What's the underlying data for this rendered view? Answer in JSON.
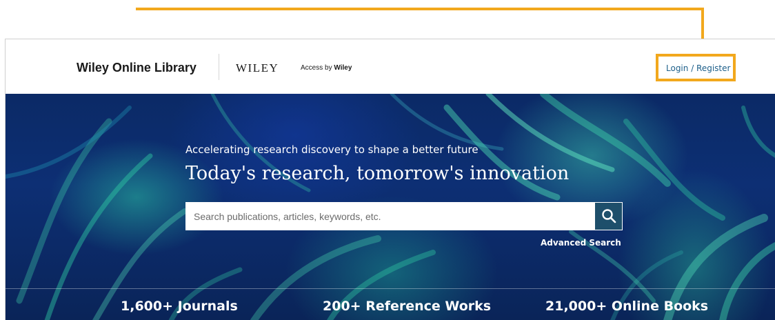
{
  "header": {
    "brand": "Wiley Online Library",
    "logo_text": "WILEY",
    "access_prefix": "Access by",
    "access_brand": "Wiley",
    "login_label": "Login / Register"
  },
  "hero": {
    "subtitle": "Accelerating research discovery to shape a better future",
    "title": "Today's research, tomorrow's innovation",
    "search": {
      "placeholder": "Search publications, articles, keywords, etc.",
      "value": ""
    },
    "advanced_search_label": "Advanced Search"
  },
  "stats": [
    {
      "label": "1,600+ Journals"
    },
    {
      "label": "200+ Reference Works"
    },
    {
      "label": "21,000+ Online Books"
    }
  ],
  "colors": {
    "annotation": "#f2a81d",
    "link": "#1d5f8a",
    "search_button": "#1e4f6b",
    "hero_base": "#0d2f74",
    "hero_accent": "#2fc9a3"
  },
  "icons": {
    "search_button": "search-icon"
  }
}
